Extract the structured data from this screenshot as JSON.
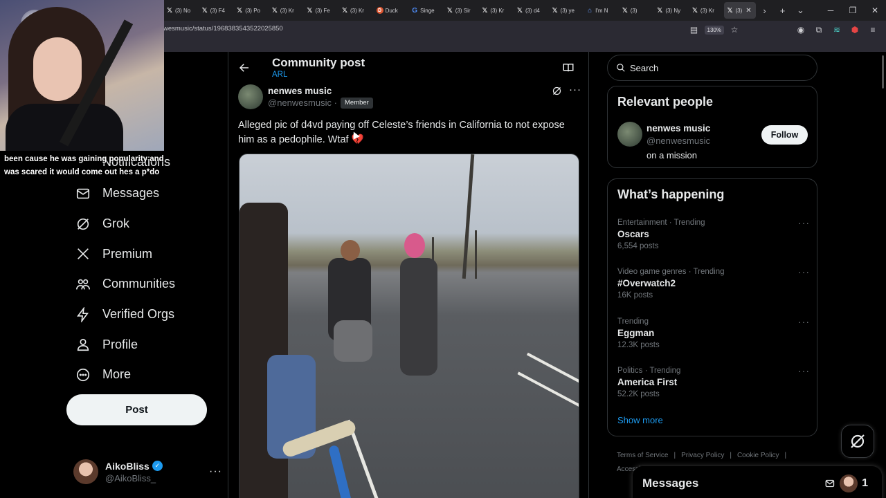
{
  "browser": {
    "tabs": [
      {
        "icon": "x-icon",
        "label": "(3) No"
      },
      {
        "icon": "x-icon",
        "label": "(3) F4"
      },
      {
        "icon": "x-icon",
        "label": "(3) Po"
      },
      {
        "icon": "x-icon",
        "label": "(3) Kr"
      },
      {
        "icon": "x-icon",
        "label": "(3) Fe"
      },
      {
        "icon": "x-icon",
        "label": "(3) Kr"
      },
      {
        "icon": "duckduckgo-icon",
        "label": "Duck"
      },
      {
        "icon": "google-icon",
        "label": "Singe"
      },
      {
        "icon": "x-icon",
        "label": "(3) Sir"
      },
      {
        "icon": "x-icon",
        "label": "(3) Kr"
      },
      {
        "icon": "x-icon",
        "label": "(3) d4"
      },
      {
        "icon": "x-icon",
        "label": "(3) ye"
      },
      {
        "icon": "news-icon",
        "label": "I'm N"
      },
      {
        "icon": "x-icon",
        "label": "(3)"
      },
      {
        "icon": "x-icon",
        "label": "(3) Ny"
      },
      {
        "icon": "x-icon",
        "label": "(3) Kr"
      }
    ],
    "active_tab": {
      "icon": "x-icon",
      "label": "(3)",
      "close": "✕"
    },
    "url": "wesmusic/status/1968383543522025850",
    "zoom": "130%"
  },
  "caption": "been cause he was gaining popularity and was scared it would come out hes a p*do",
  "nav": {
    "partial_item": "Notifications",
    "items": [
      {
        "label": "Messages",
        "icon": "mail-icon"
      },
      {
        "label": "Grok",
        "icon": "grok-icon"
      },
      {
        "label": "Premium",
        "icon": "x-logo-icon"
      },
      {
        "label": "Communities",
        "icon": "people-icon"
      },
      {
        "label": "Verified Orgs",
        "icon": "lightning-icon"
      },
      {
        "label": "Profile",
        "icon": "person-icon"
      },
      {
        "label": "More",
        "icon": "more-circle-icon"
      }
    ],
    "post_button": "Post",
    "account": {
      "name": "AikoBliss",
      "handle": "@AikoBliss_",
      "more": "···"
    }
  },
  "main": {
    "title": "Community post",
    "subtitle": "ARL",
    "author": {
      "name": "nenwes music",
      "handle": "@nenwesmusic",
      "dot": "·",
      "badge": "Member"
    },
    "post_text": "Alleged pic of d4vd paying off Celeste’s friends in California to not expose him as a pedophile. Wtaf",
    "emoji": "💔",
    "more": "···"
  },
  "right": {
    "search_placeholder": "Search",
    "relevant": {
      "title": "Relevant people",
      "name": "nenwes music",
      "handle": "@nenwesmusic",
      "bio": "on a mission",
      "follow": "Follow"
    },
    "happening": {
      "title": "What’s happening",
      "trends": [
        {
          "meta": "Entertainment · Trending",
          "name": "Oscars",
          "count": "6,554 posts"
        },
        {
          "meta": "Video game genres · Trending",
          "name": "#Overwatch2",
          "count": "16K posts"
        },
        {
          "meta": "Trending",
          "name": "Eggman",
          "count": "12.3K posts"
        },
        {
          "meta": "Politics · Trending",
          "name": "America First",
          "count": "52.2K posts"
        }
      ],
      "show_more": "Show more",
      "more": "···"
    },
    "footer": [
      "Terms of Service",
      "Privacy Policy",
      "Cookie Policy",
      "Accessi"
    ],
    "footer_sep": "|",
    "messages": {
      "title": "Messages",
      "count": "1"
    }
  }
}
